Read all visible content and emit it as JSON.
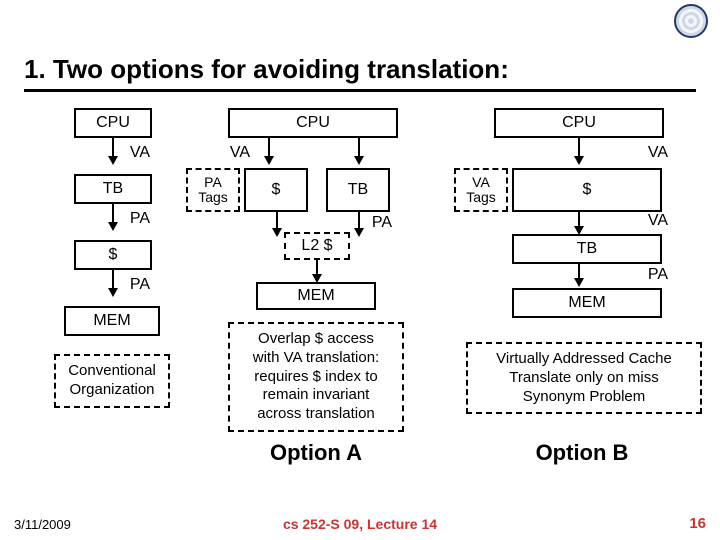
{
  "title": "1. Two options for avoiding translation:",
  "conventional": {
    "cpu": "CPU",
    "va": "VA",
    "tb": "TB",
    "pa1": "PA",
    "cache": "$",
    "pa2": "PA",
    "mem": "MEM",
    "caption": "Conventional\nOrganization"
  },
  "optionA": {
    "cpu": "CPU",
    "va": "VA",
    "pa_tags": "PA\nTags",
    "cache": "$",
    "tb": "TB",
    "pa": "PA",
    "l2": "L2 $",
    "mem": "MEM",
    "note": "Overlap $ access\nwith VA translation:\nrequires $ index to\nremain invariant\nacross translation",
    "heading": "Option A"
  },
  "optionB": {
    "cpu": "CPU",
    "va": "VA",
    "va_tags": "VA\nTags",
    "cache": "$",
    "va2": "VA",
    "tb": "TB",
    "pa": "PA",
    "mem": "MEM",
    "note": "Virtually Addressed Cache\nTranslate only on miss\nSynonym Problem",
    "heading": "Option B"
  },
  "footer": {
    "date": "3/11/2009",
    "mid": "cs 252-S 09, Lecture 14",
    "page": "16"
  }
}
